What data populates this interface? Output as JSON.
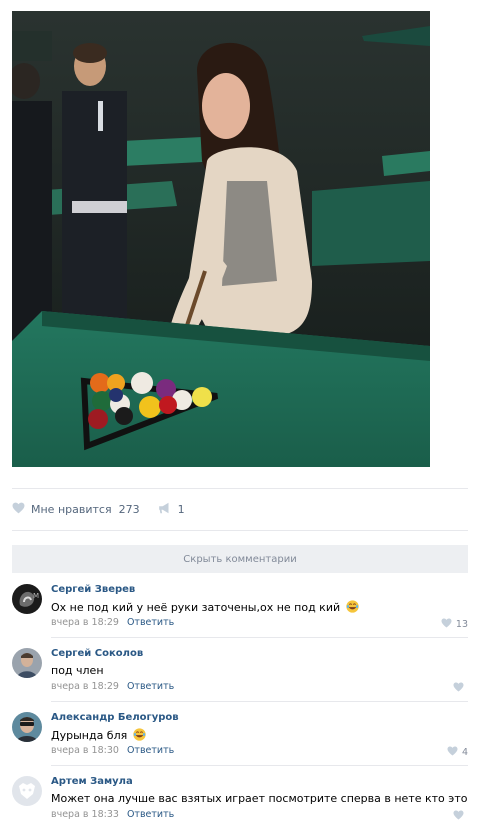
{
  "post": {
    "photo": {
      "icon": "photo-pool-girl"
    },
    "likes": {
      "label": "Мне нравится",
      "count": "273"
    },
    "shares": {
      "count": "1"
    }
  },
  "comments_toggle": {
    "label": "Скрыть комментарии"
  },
  "comments": [
    {
      "author": "Сергей Зверев",
      "text": "Ох не под кий у неё руки заточены,ох не под кий",
      "emoji": "laughing-tears-emoji",
      "time": "вчера в 18:29",
      "reply_label": "Ответить",
      "likes": "13"
    },
    {
      "author": "Сергей Соколов",
      "text": "под член",
      "time": "вчера в 18:29",
      "reply_label": "Ответить",
      "likes": ""
    },
    {
      "author": "Александр Белогуров",
      "text": "Дурында бля",
      "emoji": "laughing-tears-emoji",
      "time": "вчера в 18:30",
      "reply_label": "Ответить",
      "likes": "4"
    },
    {
      "author": "Артем Замула",
      "text": "Может она лучше вас взятых играет посмотрите сперва в нете кто это",
      "time": "вчера в 18:33",
      "reply_label": "Ответить",
      "likes": ""
    }
  ],
  "colors": {
    "link": "#2a5885",
    "muted": "#828a99",
    "divider": "#e7e8ec",
    "toggle_bg": "#edeff2",
    "felt": "#1e6b56"
  }
}
